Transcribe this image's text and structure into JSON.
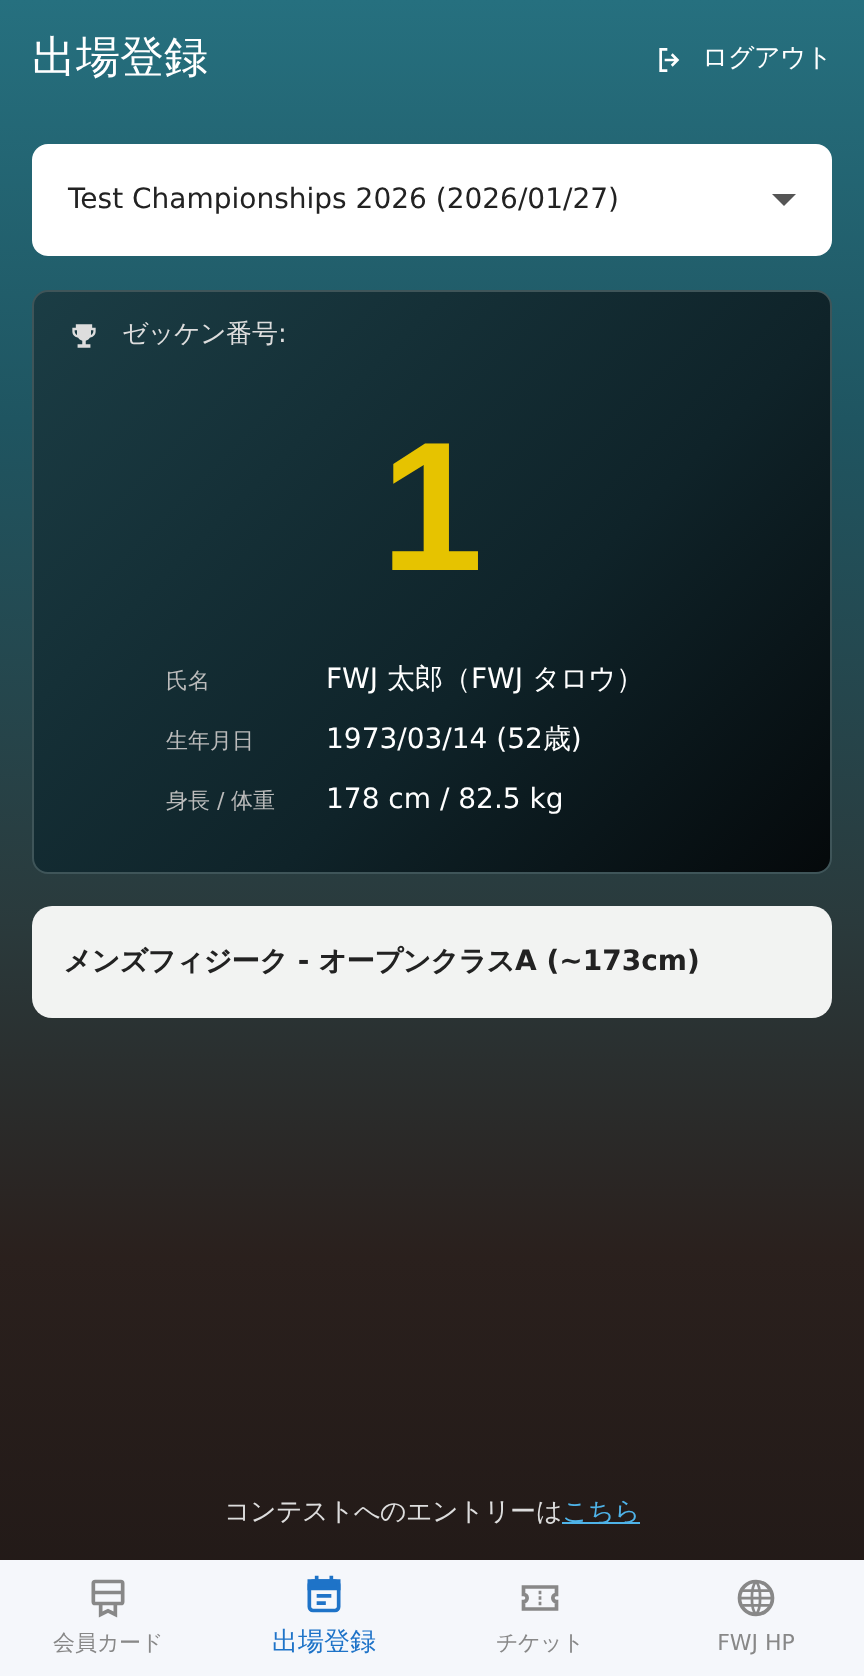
{
  "header": {
    "title": "出場登録",
    "logout": "ログアウト"
  },
  "contest_select": {
    "value": "Test Championships 2026 (2026/01/27)"
  },
  "bib_card": {
    "label": "ゼッケン番号:",
    "number": "1",
    "fields": [
      {
        "label": "氏名",
        "value": "FWJ 太郎（FWJ タロウ）"
      },
      {
        "label": "生年月日",
        "value": "1973/03/14 (52歳)"
      },
      {
        "label": "身長 / 体重",
        "value": "178 cm / 82.5 kg"
      }
    ]
  },
  "category": "メンズフィジーク - オープンクラスA (~173cm)",
  "entry_note": {
    "text": "コンテストへのエントリーは",
    "link": "こちら"
  },
  "bottom_nav": [
    {
      "kind": "card",
      "label": "会員カード",
      "selected": false
    },
    {
      "kind": "calendar",
      "label": "出場登録",
      "selected": true
    },
    {
      "kind": "ticket",
      "label": "チケット",
      "selected": false
    },
    {
      "kind": "globe",
      "label": "FWJ HP",
      "selected": false
    }
  ]
}
